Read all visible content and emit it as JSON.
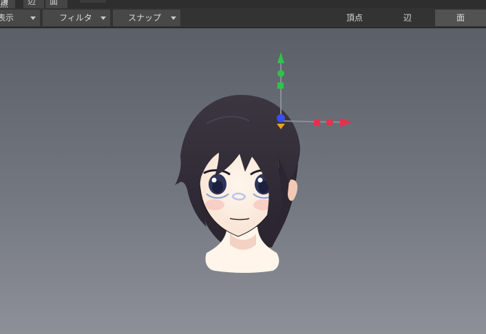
{
  "top_menu": {
    "vertex_label": "頂点",
    "edge_label": "辺",
    "face_label": "面"
  },
  "toolbar": {
    "display_label": "表示",
    "filter_label": "フィルタ",
    "snap_label": "スナップ"
  },
  "selection_modes": {
    "vertex_label": "頂点",
    "edge_label": "辺",
    "face_label": "面",
    "active": "face"
  },
  "viewport": {
    "object": "anime-girl-head-model",
    "gizmo_colors": {
      "x": "#e8304a",
      "y": "#2ec44a",
      "z": "#3a4ee8",
      "center": "#f0a020"
    }
  }
}
